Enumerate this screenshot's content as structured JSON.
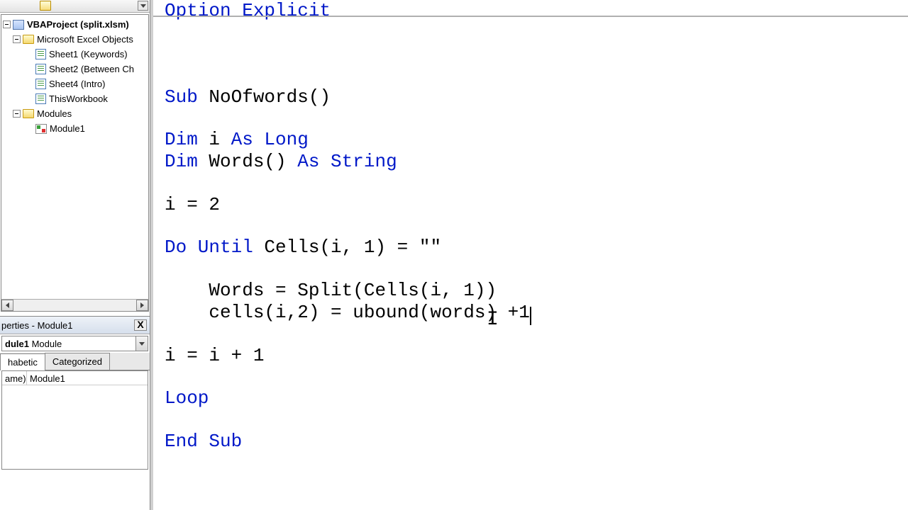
{
  "tree": {
    "project": "VBAProject (split.xlsm)",
    "excelObjects": "Microsoft Excel Objects",
    "sheet1": "Sheet1 (Keywords)",
    "sheet2": "Sheet2 (Between Ch",
    "sheet4": "Sheet4 (Intro)",
    "thisWorkbook": "ThisWorkbook",
    "modulesFolder": "Modules",
    "module1": "Module1"
  },
  "props": {
    "title": "perties - Module1",
    "selectorBold": "dule1",
    "selectorRest": " Module",
    "tabAlpha": "habetic",
    "tabCat": "Categorized",
    "nameKey": "ame)",
    "nameVal": "Module1"
  },
  "closeLabel": "X",
  "code": {
    "l0a": "Option Explicit",
    "l1a": "Sub",
    "l1b": " NoOfwords()",
    "l2a": "Dim",
    "l2b": " i ",
    "l2c": "As Long",
    "l3a": "Dim",
    "l3b": " Words() ",
    "l3c": "As String",
    "l4": "i = 2",
    "l5a": "Do Until",
    "l5b": " Cells(i, 1) = \"\"",
    "l6": "    Words = Split(Cells(i, 1))",
    "l7": "    cells(i,2) = ubound(words) +1",
    "l8": "i = i + 1",
    "l9": "Loop",
    "l10a": "End Sub"
  }
}
